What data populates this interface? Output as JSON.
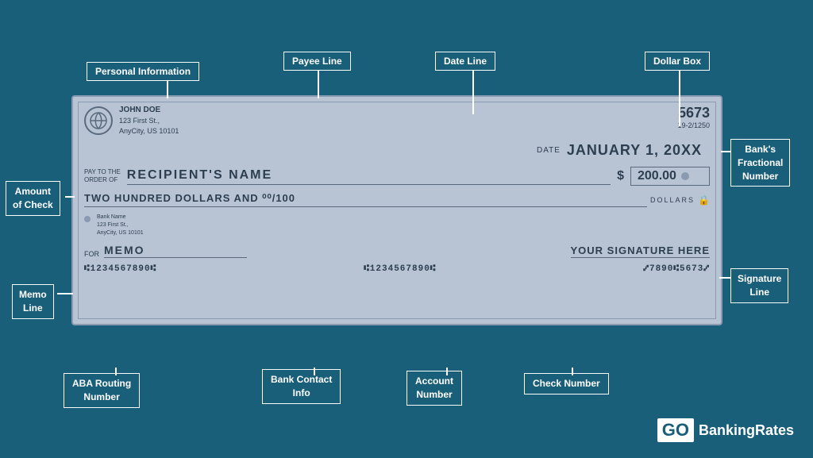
{
  "background_color": "#1a5f7a",
  "check": {
    "name": "JOHN DOE",
    "address_line1": "123 First St.,",
    "address_line2": "AnyCity, US 10101",
    "check_number": "5673",
    "fractional": "19-2/1250",
    "date_label": "DATE",
    "date_value": "JANUARY 1, 20XX",
    "pay_to_label_line1": "PAY TO THE",
    "pay_to_label_line2": "ORDER OF",
    "recipient": "RECIPIENT'S NAME",
    "dollar_sign": "$",
    "amount": "200.00",
    "written_amount": "TWO HUNDRED DOLLARS AND ⁰⁰/100",
    "dollars_label": "DOLLARS",
    "bank_name": "Bank Name",
    "bank_address1": "123 First St.,",
    "bank_address2": "AnyCity, US 10101",
    "for_label": "FOR",
    "memo": "MEMO",
    "signature": "YOUR SIGNATURE HERE",
    "routing_left": "•¹1234567890¹•",
    "routing_middle": "•¹1234567890¹•",
    "routing_right": "¢¹7890•¹5673¢"
  },
  "labels": {
    "personal_information": "Personal Information",
    "payee_line": "Payee Line",
    "date_line": "Date Line",
    "dollar_box": "Dollar Box",
    "banks_fractional_number_line1": "Bank's",
    "banks_fractional_number_line2": "Fractional",
    "banks_fractional_number_line3": "Number",
    "amount_of_check_line1": "Amount",
    "amount_of_check_line2": "of Check",
    "memo_line_line1": "Memo",
    "memo_line_line2": "Line",
    "signature_line_line1": "Signature",
    "signature_line_line2": "Line",
    "aba_routing_line1": "ABA Routing",
    "aba_routing_line2": "Number",
    "bank_contact_line1": "Bank Contact",
    "bank_contact_line2": "Info",
    "account_number_line1": "Account",
    "account_number_line2": "Number",
    "check_number_line1": "Check Number"
  },
  "logo": {
    "go": "GO",
    "text": "BankingRates"
  }
}
